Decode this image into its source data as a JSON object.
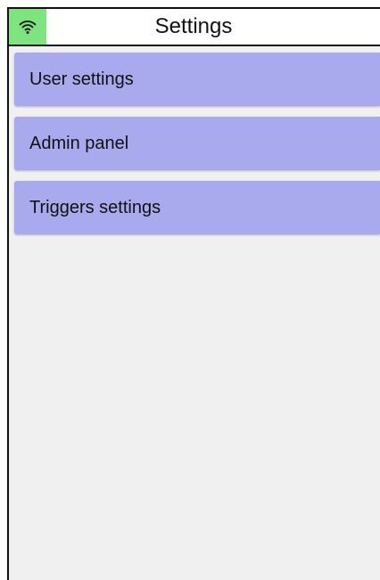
{
  "header": {
    "title": "Settings",
    "wifi_icon": "wifi-icon",
    "wifi_bg_color": "#7fe37f"
  },
  "menu": {
    "items": [
      {
        "label": "User settings"
      },
      {
        "label": "Admin panel"
      },
      {
        "label": "Triggers settings"
      }
    ],
    "item_color": "#a9a9ee"
  },
  "colors": {
    "background": "#f0f0f0",
    "border": "#111111"
  }
}
